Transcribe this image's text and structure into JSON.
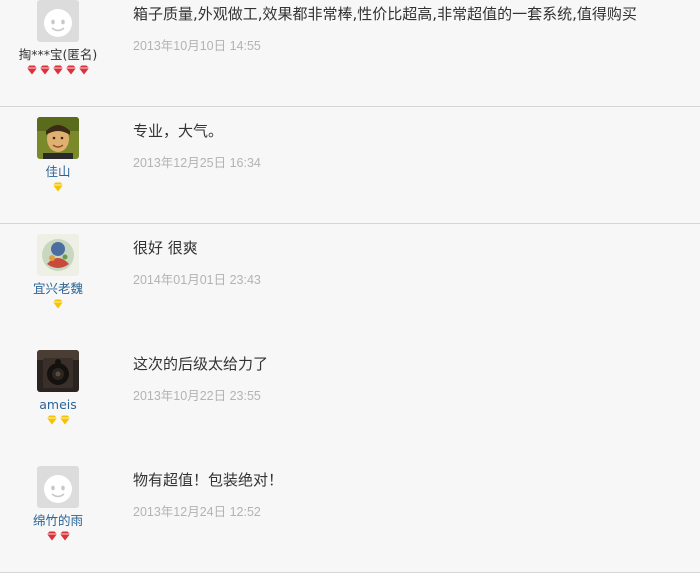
{
  "colors": {
    "row_background": "#f7f7f7",
    "divider": "#d6d6d6",
    "username_link": "#2a6496",
    "comment_text": "#333333",
    "timestamp": "#b3b3b3",
    "badge_red": "#d9323c",
    "badge_gold": "#f5c400"
  },
  "reviews": [
    {
      "user": "掏***宝(匿名)",
      "avatar": "default-avatar-icon",
      "badge_type": "red-diamond-icon",
      "badge_count": 5,
      "comment": "箱子质量,外观做工,效果都非常棒,性价比超高,非常超值的一套系统,值得购买",
      "time": "2013年10月10日 14:55"
    },
    {
      "user": "佳山",
      "avatar": "user-photo-icon",
      "badge_type": "gold-diamond-icon",
      "badge_count": 1,
      "comment": "专业，大气。",
      "time": "2013年12月25日 16:34"
    },
    {
      "user": "宜兴老魏",
      "avatar": "user-photo-icon",
      "badge_type": "gold-diamond-icon",
      "badge_count": 1,
      "comment": "很好 很爽",
      "time": "2014年01月01日 23:43"
    },
    {
      "user": "ameis",
      "avatar": "user-photo-icon",
      "badge_type": "gold-diamond-icon",
      "badge_count": 2,
      "comment": "这次的后级太给力了",
      "time": "2013年10月22日 23:55"
    },
    {
      "user": "绵竹的雨",
      "avatar": "default-avatar-icon",
      "badge_type": "red-diamond-icon",
      "badge_count": 2,
      "comment": "物有超值！包装绝对！",
      "time": "2013年12月24日 12:52"
    }
  ]
}
